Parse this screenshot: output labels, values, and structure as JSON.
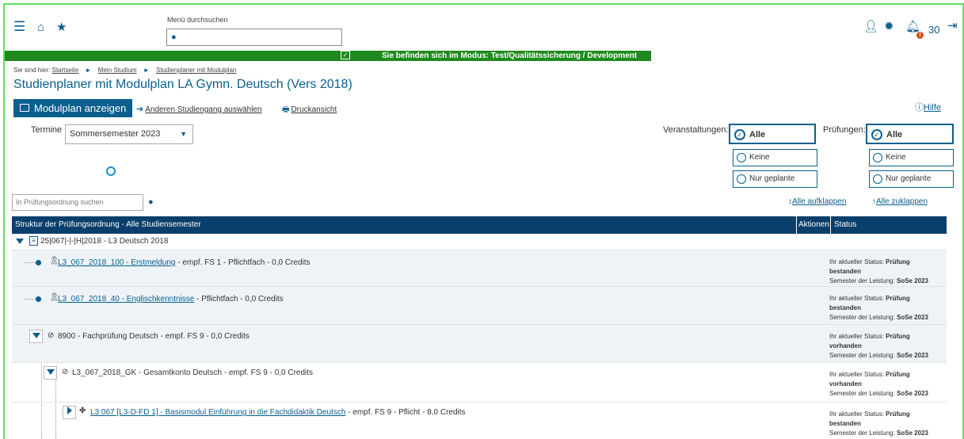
{
  "topbar": {
    "search_label": "Menü durchsuchen",
    "counter": "30",
    "badge": "!",
    "icons": [
      "menu-icon",
      "home-icon",
      "star-icon",
      "user-icon",
      "gear-icon",
      "bell-icon",
      "logout-icon"
    ]
  },
  "mode_banner": "Sie befinden sich im Modus: Test/Qualitätssicherung / Development",
  "breadcrumb": {
    "prefix": "Sie sind hier:",
    "items": [
      "Startseite",
      "Mein Studium",
      "Studienplaner mit Modulplan"
    ]
  },
  "page_title": "Studienplaner mit Modulplan LA Gymn. Deutsch (Vers 2018)",
  "actions": {
    "modulplan": "Modulplan anzeigen",
    "anderen": "Anderen Studiengang auswählen",
    "druck": "Druckansicht",
    "hilfe": "Hilfe"
  },
  "termine": {
    "label": "Termine",
    "selected": "Sommersemester 2023"
  },
  "filters": {
    "veranstaltungen_label": "Veranstaltungen:",
    "pruefungen_label": "Prüfungen:",
    "options": [
      "Alle",
      "Keine",
      "Nur geplante"
    ]
  },
  "po_search_placeholder": "In Prüfungsordnung suchen",
  "expand": {
    "open": "Alle aufklappen",
    "close": "Alle zuklappen"
  },
  "table": {
    "headers": [
      "Struktur der Prüfungsordnung - Alle Studiensemester",
      "Aktionen",
      "Status"
    ],
    "root": "25|067|-|-|H|2018 - L3 Deutsch 2018",
    "rows": [
      {
        "link": "L3_067_2018_100 - Erstmeldung",
        "rest": " - empf. FS 1 - Pflichtfach - 0,0 Credits",
        "status_prefix": "Ihr aktueller Status:",
        "status_a": "Prüfung",
        "status_b": "bestanden",
        "sem_prefix": "Semester der Leistung:",
        "sem": "SoSe 2023"
      },
      {
        "link": "L3_067_2018_40 - Englischkenntnisse",
        "rest": " - Pflichtfach - 0,0 Credits",
        "status_prefix": "Ihr aktueller Status:",
        "status_a": "Prüfung",
        "status_b": "bestanden",
        "sem_prefix": "Semester der Leistung:",
        "sem": "SoSe 2023"
      },
      {
        "link": "",
        "rest": "8900 - Fachprüfung Deutsch - empf. FS 9 - 0,0 Credits",
        "status_prefix": "Ihr aktueller Status:",
        "status_a": "Prüfung",
        "status_b": "vorhanden",
        "sem_prefix": "Semester der Leistung:",
        "sem": "SoSe 2023"
      },
      {
        "link": "",
        "rest": "L3_067_2018_GK - Gesamtkonto Deutsch - empf. FS 9 - 0,0 Credits",
        "status_prefix": "Ihr aktueller Status:",
        "status_a": "Prüfung",
        "status_b": "vorhanden",
        "sem_prefix": "Semester der Leistung:",
        "sem": "SoSe 2023"
      },
      {
        "link": "L3 067 [L3-D-FD 1] - Basismodul Einführung in die Fachdidaktik Deutsch",
        "rest": " - empf. FS 9 - Pflicht - 8,0 Credits",
        "status_prefix": "Ihr aktueller Status:",
        "status_a": "Prüfung",
        "status_b": "bestanden",
        "sem_prefix": "Semester der Leistung:",
        "sem": "SoSe 2023"
      }
    ]
  },
  "colors": {
    "primary": "#0a5f8d",
    "header": "#0a3f6b",
    "banner": "#1e8a1e"
  }
}
